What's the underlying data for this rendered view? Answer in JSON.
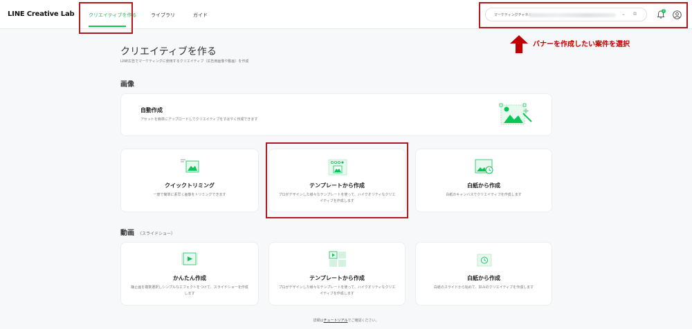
{
  "header": {
    "logo": "LINE Creative Lab",
    "nav": [
      "クリエイティブを作る",
      "ライブラリ",
      "ガイド"
    ],
    "channel_label": "マーケティングチャネル",
    "notification_count": "3"
  },
  "annotation": {
    "text": "バナーを作成したい案件を選択"
  },
  "page": {
    "title": "クリエイティブを作る",
    "subtitle": "LINE広告でマーケティングに使用するクリエイティブ（広告用画像や動画）を作成"
  },
  "image_section": {
    "title": "画像",
    "auto": {
      "title": "自動作成",
      "desc": "アセットを簡単にアップロードしてクリエイティブをすばやく作成できます"
    },
    "cards": [
      {
        "title": "クイックトリミング",
        "desc": "一度で簡単に素早く画像をトリミングできます"
      },
      {
        "title": "テンプレートから作成",
        "desc": "プロがデザインした様々なテンプレートを使って、ハイクオリティなクリエイティブを作成します"
      },
      {
        "title": "白紙から作成",
        "desc": "白紙のキャンバスでクリエイティブを作成します"
      }
    ]
  },
  "video_section": {
    "title": "動画",
    "note": "（スライドショー）",
    "cards": [
      {
        "title": "かんたん作成",
        "desc": "静止画を複数選択しシンプルなエフェクトをつけて、スライドショーを作成します"
      },
      {
        "title": "テンプレートから作成",
        "desc": "プロがデザインした様々なテンプレートを使って、ハイクオリティなクリエイティブを作成します"
      },
      {
        "title": "白紙から作成",
        "desc": "白紙のスライドから始めて、好みのクリエイティブを作成します"
      }
    ]
  },
  "footer": {
    "prefix": "詳細は",
    "link": "チュートリアル",
    "suffix": "でご確認ください。"
  },
  "colors": {
    "accent": "#06c755",
    "annotation": "#c00000",
    "highlight_box": "#b0181b"
  }
}
